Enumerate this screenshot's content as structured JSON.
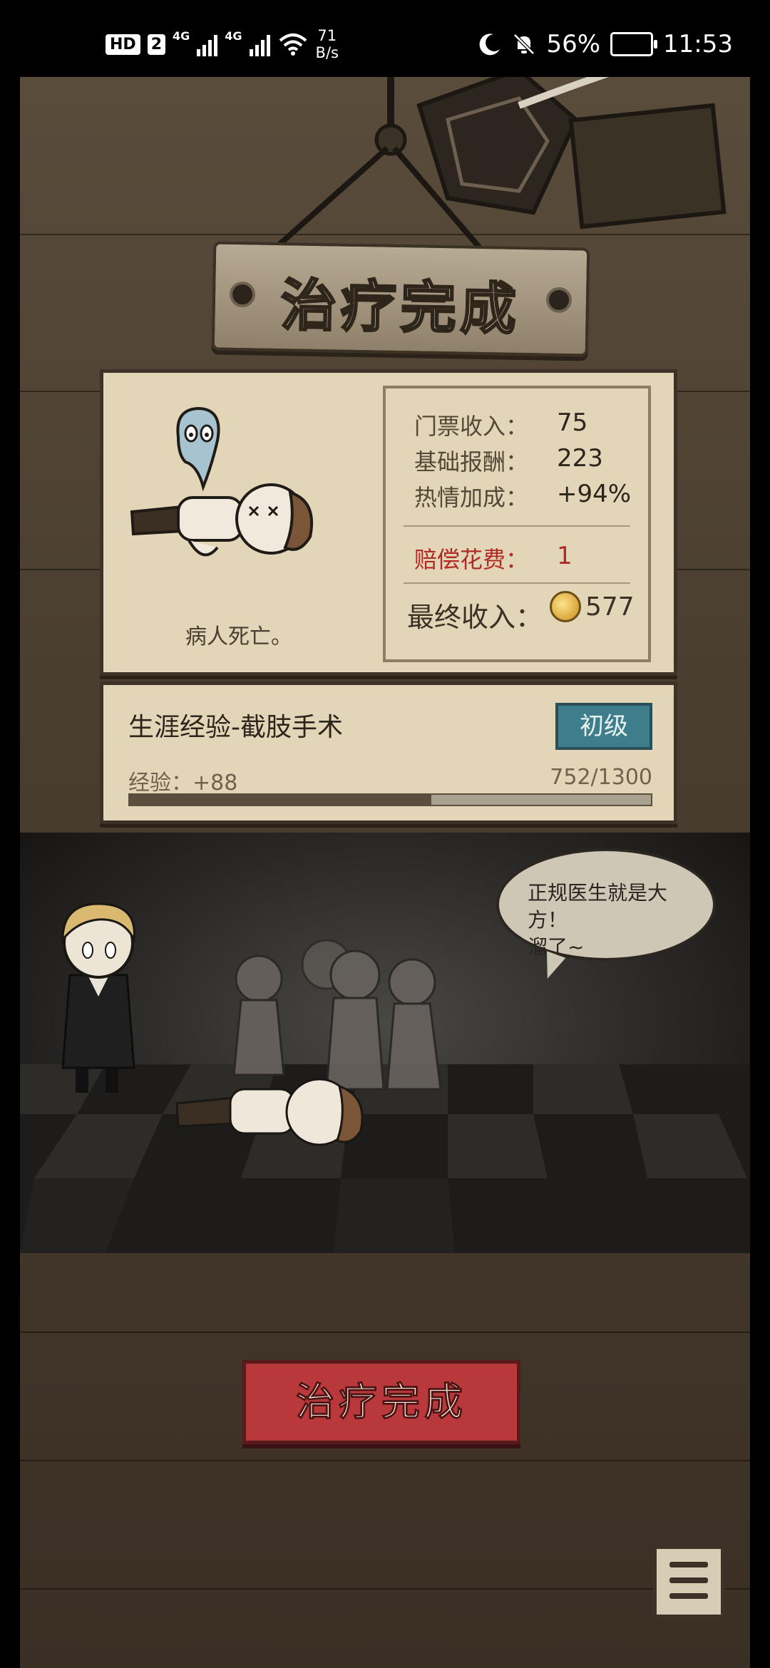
{
  "status_bar": {
    "hd": "HD",
    "sim": "2",
    "net1": "4G",
    "net2": "4G",
    "speed_value": "71",
    "speed_unit": "B/s",
    "battery": "56%",
    "time": "11:53"
  },
  "title": "治疗完成",
  "result": {
    "death_caption": "病人死亡。",
    "ticket_label": "门票收入：",
    "ticket_value": "75",
    "base_label": "基础报酬：",
    "base_value": "223",
    "passion_label": "热情加成：",
    "passion_value": "+94%",
    "compensation_label": "赔偿花费：",
    "compensation_value": "1",
    "final_label": "最终收入：",
    "final_value": "577"
  },
  "experience": {
    "title": "生涯经验-截肢手术",
    "rank": "初级",
    "gain": "经验：+88",
    "count": "752/1300",
    "progress": 0.578
  },
  "scene": {
    "speech_line1": "正规医生就是大方！",
    "speech_line2": "溜了~"
  },
  "done_button": "治疗完成",
  "icons": [
    "hd-icon",
    "signal-icon",
    "wifi-icon",
    "moon-icon",
    "mute-bell-icon",
    "battery-icon",
    "coin-icon",
    "menu-list-icon"
  ],
  "colors": {
    "accent_red": "#b8383c",
    "badge_teal": "#3e7d8c",
    "paper": "#e3d6b8"
  }
}
